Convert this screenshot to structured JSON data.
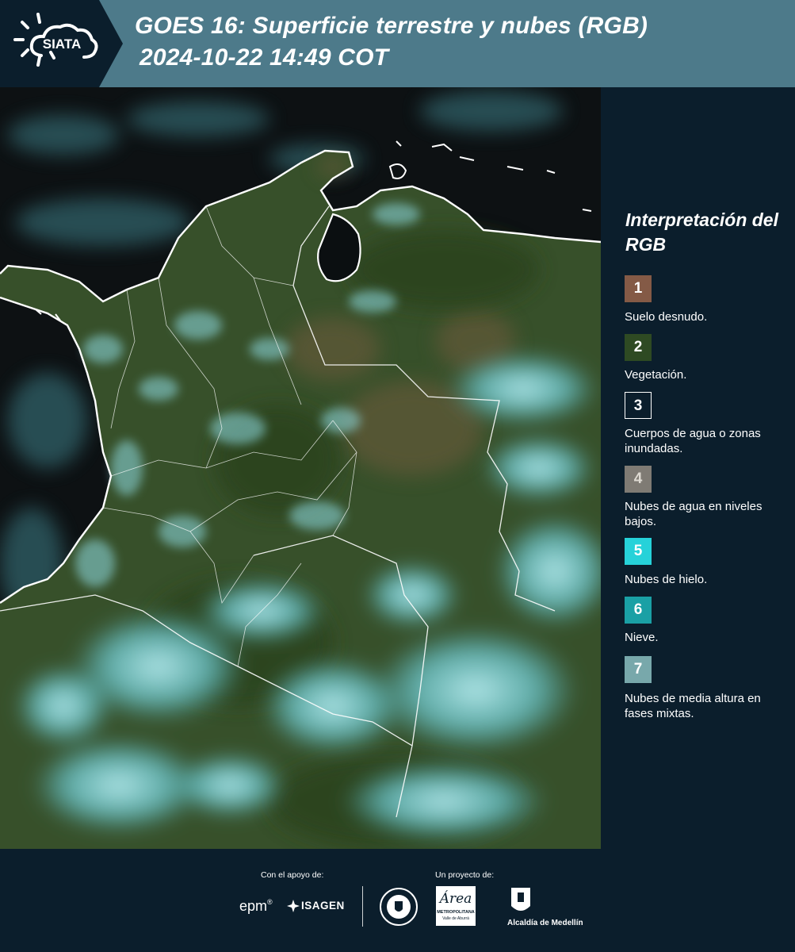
{
  "header": {
    "logo_text": "SIATA",
    "title_line1": "GOES 16: Superficie terrestre y nubes (RGB)",
    "title_line2": "2024-10-22 14:49 COT"
  },
  "colors": {
    "header_bg": "#4d7a8a",
    "logo_bg": "#0b1e2c",
    "page_bg": "#0b1e2c",
    "ocean": "#0c1012",
    "vegetation": "#37502a",
    "cloud_cyan": "#66cdd8"
  },
  "legend": {
    "title": "Interpretación del RGB",
    "items": [
      {
        "number": "1",
        "label": "Suelo desnudo.",
        "color": "#845a46"
      },
      {
        "number": "2",
        "label": "Vegetación.",
        "color": "#2e4a23"
      },
      {
        "number": "3",
        "label": "Cuerpos de agua o zonas inundadas.",
        "color": "#0b1e2c"
      },
      {
        "number": "4",
        "label": "Nubes de agua en niveles bajos.",
        "color": "#7f7b74"
      },
      {
        "number": "5",
        "label": "Nubes de hielo.",
        "color": "#26d2d9"
      },
      {
        "number": "6",
        "label": "Nieve.",
        "color": "#1aa0a5"
      },
      {
        "number": "7",
        "label": "Nubes de media altura en fases mixtas.",
        "color": "#78a8ab"
      }
    ]
  },
  "footer": {
    "support_label": "Con el apoyo de:",
    "project_label": "Un proyecto de:",
    "sponsors": [
      {
        "name": "epm",
        "text": "epm",
        "icon": "epm-logo"
      },
      {
        "name": "isagen",
        "text": "ISAGEN",
        "icon": "isagen-logo"
      },
      {
        "name": "medellin-seal",
        "text": "",
        "icon": "medellin-seal"
      },
      {
        "name": "area-metropolitana",
        "text": "Área",
        "sub1": "METROPOLITANA",
        "sub2": "Valle de Aburrá",
        "icon": "area-metropolitana-logo"
      },
      {
        "name": "alcaldia",
        "text": "Alcaldía de Medellín",
        "icon": "alcaldia-logo"
      }
    ]
  }
}
